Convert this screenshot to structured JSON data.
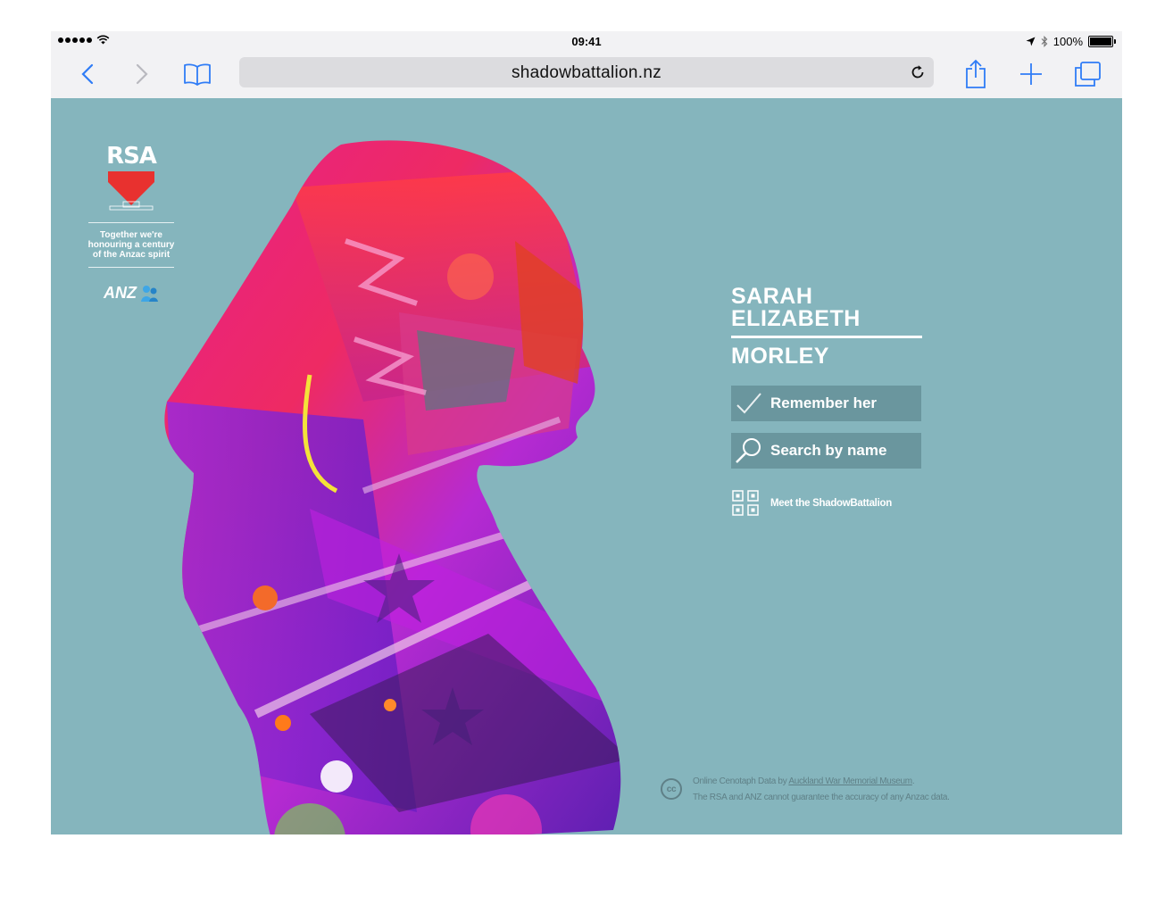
{
  "status_bar": {
    "time": "09:41",
    "battery": "100%",
    "icons": [
      "signal-dots-icon",
      "wifi-icon",
      "location-arrow-icon",
      "bluetooth-icon",
      "battery-icon"
    ]
  },
  "toolbar": {
    "url": "shadowbattalion.nz",
    "icons": [
      "back-chevron-icon",
      "forward-chevron-icon",
      "bookmarks-icon",
      "reload-icon",
      "share-icon",
      "new-tab-plus-icon",
      "tabs-icon"
    ]
  },
  "branding": {
    "rsa_logo": "RSA",
    "tagline_line1": "Together we're",
    "tagline_line2": "honouring a century",
    "tagline_line3": "of the Anzac spirit",
    "anz_logo": "ANZ"
  },
  "profile": {
    "first_names_line1": "SARAH",
    "first_names_line2": "ELIZABETH",
    "surname": "MORLEY"
  },
  "actions": {
    "remember_label": "Remember her",
    "search_label": "Search by name",
    "meet_label": "Meet the ShadowBattalion"
  },
  "footer": {
    "cc_badge": "cc",
    "credit_prefix": "Online Cenotaph Data by ",
    "credit_link": "Auckland War Memorial Museum",
    "credit_suffix": ".",
    "disclaimer": "The RSA and ANZ cannot guarantee the accuracy of any Anzac data."
  },
  "colors": {
    "page_background": "#85b5bd",
    "button_background": "#6a969e",
    "ios_tint": "#2f7cf6"
  }
}
